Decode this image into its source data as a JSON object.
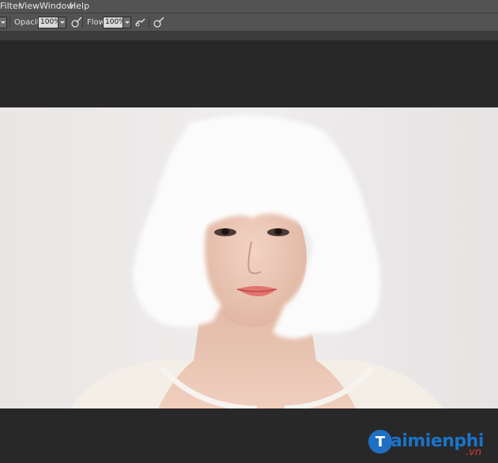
{
  "menu": {
    "filter": "Filter",
    "view": "View",
    "window": "Window",
    "help": "Help"
  },
  "options": {
    "opacity_label": "Opacity:",
    "opacity_value": "100%",
    "flow_label": "Flow:",
    "flow_value": "100%"
  },
  "watermark": {
    "brand": "aimienphi",
    "tld": ".vn",
    "initial": "T"
  }
}
